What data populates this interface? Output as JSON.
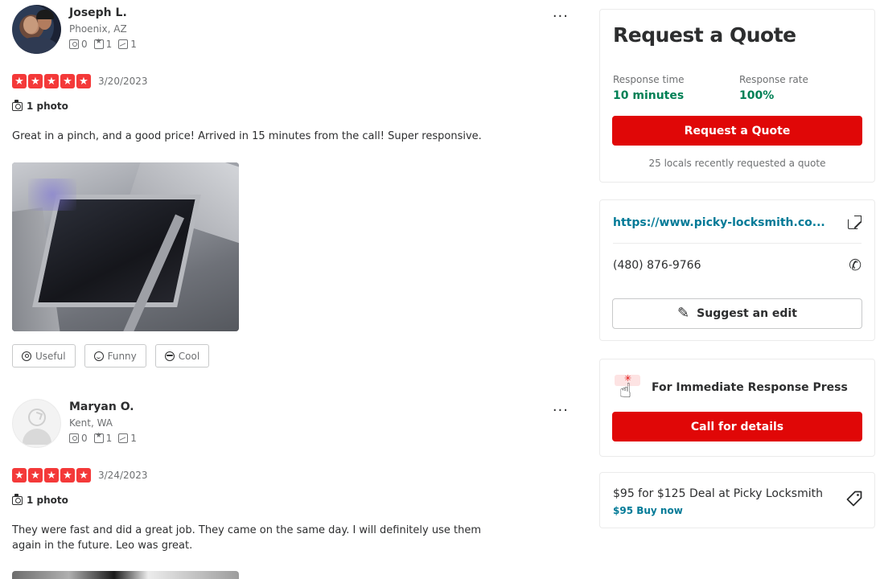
{
  "reviews": [
    {
      "name": "Joseph L.",
      "location": "Phoenix, AZ",
      "stats": {
        "friends": "0",
        "reviews": "1",
        "photos": "1"
      },
      "rating": 5,
      "date": "3/20/2023",
      "photo_count": "1 photo",
      "text": "Great in a pinch, and a good price! Arrived in 15 minutes from the call! Super responsive.",
      "reactions": {
        "useful": "Useful",
        "funny": "Funny",
        "cool": "Cool"
      },
      "more": "···"
    },
    {
      "name": "Maryan O.",
      "location": "Kent, WA",
      "stats": {
        "friends": "0",
        "reviews": "1",
        "photos": "1"
      },
      "rating": 5,
      "date": "3/24/2023",
      "photo_count": "1 photo",
      "text": "They were fast and did a great job. They came on the same day. I will definitely use them again in the future. Leo was great.",
      "more": "···"
    }
  ],
  "quote_card": {
    "title": "Request a Quote",
    "response_time_label": "Response time",
    "response_time_value": "10 minutes",
    "response_rate_label": "Response rate",
    "response_rate_value": "100%",
    "button": "Request a Quote",
    "subtext": "25 locals recently requested a quote"
  },
  "contact_card": {
    "website": "https://www.picky-locksmith.co...",
    "phone": "(480) 876-9766",
    "suggest_edit": "Suggest an edit"
  },
  "immediate_card": {
    "text": "For Immediate Response Press",
    "button": "Call for details"
  },
  "deal_card": {
    "title": "$95 for $125 Deal at Picky Locksmith",
    "link": "$95 Buy now"
  },
  "colors": {
    "brand_red": "#e00707",
    "star_red": "#f43939",
    "success_green": "#008055",
    "link_teal": "#027a97"
  },
  "icons": {
    "more": "more-horizontal-icon",
    "camera": "camera-icon",
    "external": "external-link-icon",
    "phone": "phone-icon",
    "pencil": "pencil-icon",
    "tap": "tap-hand-icon",
    "tag": "tag-icon"
  }
}
